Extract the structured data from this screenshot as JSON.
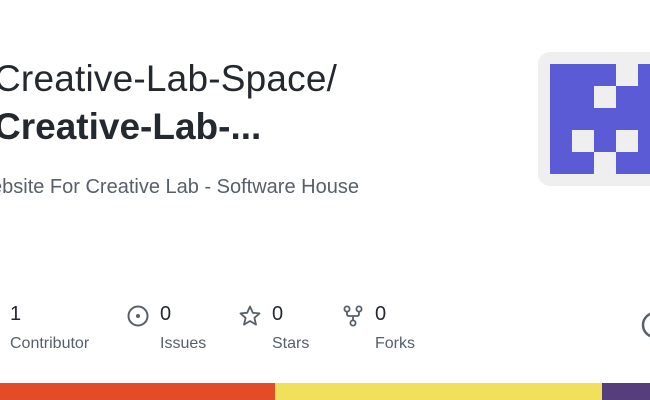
{
  "repo": {
    "owner_line": "Creative-Lab-Space/",
    "name_line": "Creative-Lab-...",
    "description": "ebsite For Creative Lab - Software House"
  },
  "stats": {
    "contributors": {
      "count": "1",
      "label": "Contributor"
    },
    "issues": {
      "count": "0",
      "label": "Issues"
    },
    "stars": {
      "count": "0",
      "label": "Stars"
    },
    "forks": {
      "count": "0",
      "label": "Forks"
    }
  },
  "avatar": {
    "fg_color": "#5b5bd6",
    "bg_color": "#efefef"
  },
  "language_bar": [
    {
      "color": "#e34c26"
    },
    {
      "color": "#f1e05a"
    },
    {
      "color": "#563d7c"
    }
  ]
}
